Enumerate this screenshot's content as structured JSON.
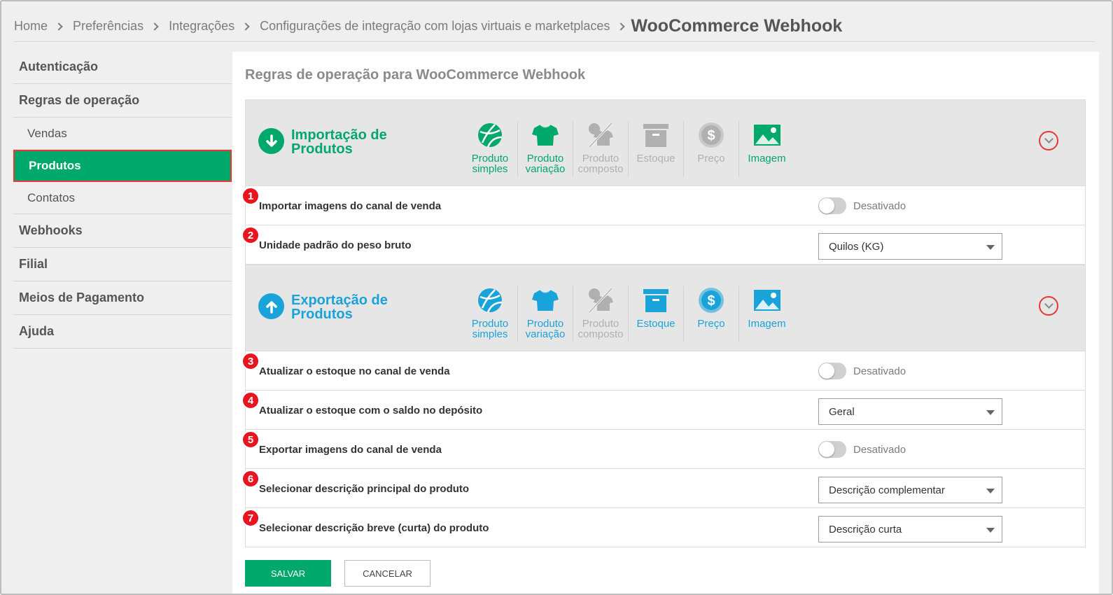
{
  "breadcrumb": {
    "items": [
      "Home",
      "Preferências",
      "Integrações",
      "Configurações de integração com lojas virtuais e marketplaces"
    ],
    "current": "WooCommerce Webhook"
  },
  "sidebar": {
    "items": [
      {
        "label": "Autenticação"
      },
      {
        "label": "Regras de operação"
      },
      {
        "label": "Vendas"
      },
      {
        "label": "Produtos"
      },
      {
        "label": "Contatos"
      },
      {
        "label": "Webhooks"
      },
      {
        "label": "Filial"
      },
      {
        "label": "Meios de Pagamento"
      },
      {
        "label": "Ajuda"
      }
    ]
  },
  "main": {
    "title": "Regras de operação para WooCommerce Webhook",
    "import": {
      "title_line1": "Importação de",
      "title_line2": "Produtos",
      "color": "#00a86b",
      "types": [
        {
          "line1": "Produto",
          "line2": "simples",
          "icon": "ball-icon",
          "active": true
        },
        {
          "line1": "Produto",
          "line2": "variação",
          "icon": "tshirt-icon",
          "active": true
        },
        {
          "line1": "Produto",
          "line2": "composto",
          "icon": "composite-icon",
          "active": false
        },
        {
          "line1": "Estoque",
          "line2": "",
          "icon": "box-icon",
          "active": false
        },
        {
          "line1": "Preço",
          "line2": "",
          "icon": "dollar-icon",
          "active": false
        },
        {
          "line1": "Imagem",
          "line2": "",
          "icon": "image-icon",
          "active": true
        }
      ],
      "rows": [
        {
          "num": "1",
          "label": "Importar imagens do canal de venda",
          "status": "Desativado"
        },
        {
          "num": "2",
          "label": "Unidade padrão do peso bruto",
          "value": "Quilos (KG)"
        }
      ]
    },
    "export": {
      "title_line1": "Exportação de",
      "title_line2": "Produtos",
      "color": "#1aa3d9",
      "types": [
        {
          "line1": "Produto",
          "line2": "simples",
          "icon": "ball-icon",
          "active": true
        },
        {
          "line1": "Produto",
          "line2": "variação",
          "icon": "tshirt-icon",
          "active": true
        },
        {
          "line1": "Produto",
          "line2": "composto",
          "icon": "composite-icon",
          "active": false
        },
        {
          "line1": "Estoque",
          "line2": "",
          "icon": "box-icon",
          "active": true
        },
        {
          "line1": "Preço",
          "line2": "",
          "icon": "dollar-icon",
          "active": true
        },
        {
          "line1": "Imagem",
          "line2": "",
          "icon": "image-icon",
          "active": true
        }
      ],
      "rows": [
        {
          "num": "3",
          "label": "Atualizar o estoque no canal de venda",
          "status": "Desativado"
        },
        {
          "num": "4",
          "label": "Atualizar o estoque com o saldo no depósito",
          "value": "Geral"
        },
        {
          "num": "5",
          "label": "Exportar imagens do canal de venda",
          "status": "Desativado"
        },
        {
          "num": "6",
          "label": "Selecionar descrição principal do produto",
          "value": "Descrição complementar"
        },
        {
          "num": "7",
          "label": "Selecionar descrição breve (curta) do produto",
          "value": "Descrição curta"
        }
      ]
    },
    "save_label": "SALVAR",
    "cancel_label": "CANCELAR"
  },
  "colors": {
    "green": "#00a86b",
    "blue": "#1aa3d9",
    "inactive": "#b0b0b0",
    "badge": "#e8141f"
  }
}
